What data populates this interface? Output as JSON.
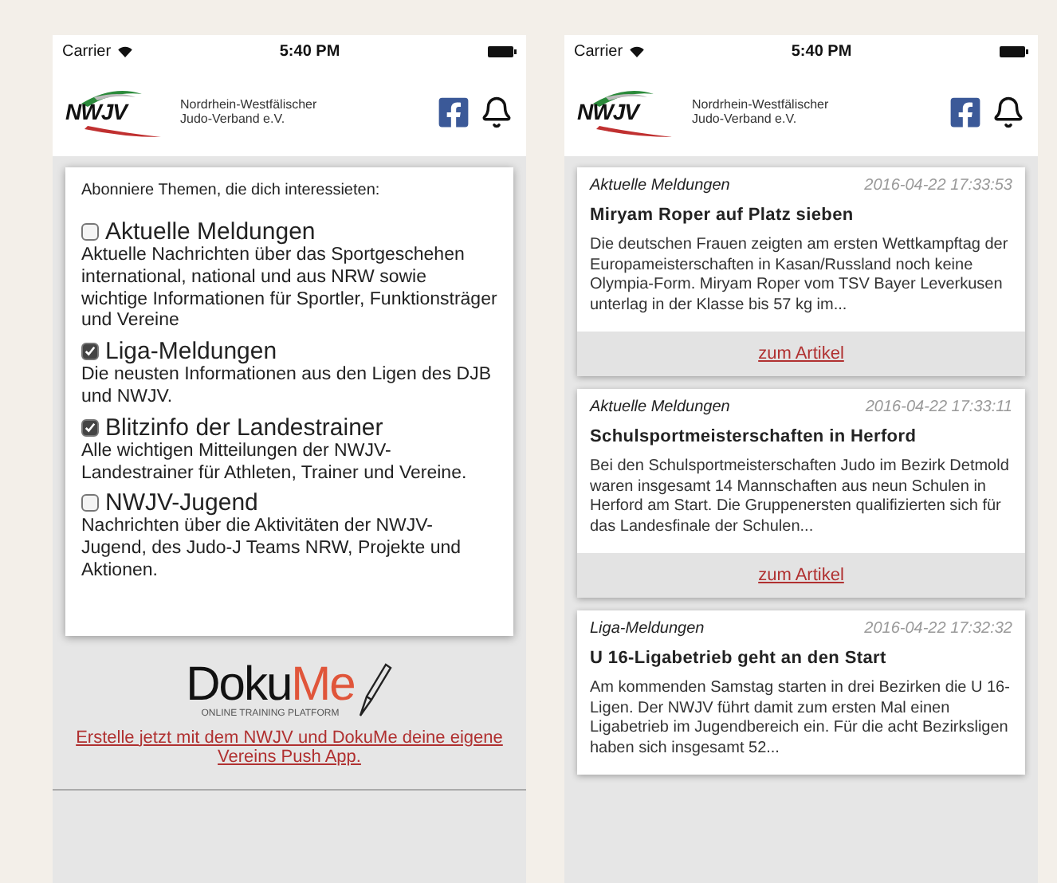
{
  "screens": [
    {
      "kind": "topics",
      "status_bar": {
        "carrier": "Carrier",
        "time": "5:40 PM"
      },
      "header": {
        "logo_text": "NWJV",
        "org_lines": [
          "Nordrhein-Westfälischer",
          "Judo-Verband e.V."
        ]
      },
      "intro": "Abonniere Themen, die dich interessieten:",
      "topics": [
        {
          "title": "Aktuelle Meldungen",
          "description": "Aktuelle Nachrichten über das Sportgeschehen international, national und aus NRW sowie wichtige Informationen für Sportler, Funktionsträger und Vereine",
          "checked": false
        },
        {
          "title": "Liga-Meldungen",
          "description": "Die neusten Informationen aus den Ligen des DJB und NWJV.",
          "checked": true
        },
        {
          "title": "Blitzinfo der Landestrainer",
          "description": "Alle wichtigen Mitteilungen der NWJV-Landestrainer für Athleten, Trainer und Vereine.",
          "checked": true
        },
        {
          "title": "NWJV-Jugend",
          "description": "Nachrichten über die Aktivitäten der NWJV-Jugend, des Judo-J Teams NRW, Projekte und Aktionen.",
          "checked": false
        }
      ],
      "promo": {
        "brand_dark": "Doku",
        "brand_accent": "Me",
        "tagline": "ONLINE TRAINING PLATFORM",
        "link": "Erstelle jetzt mit dem NWJV und DokuMe deine eigene Vereins Push App."
      }
    },
    {
      "kind": "news",
      "status_bar": {
        "carrier": "Carrier",
        "time": "5:40 PM"
      },
      "header": {
        "logo_text": "NWJV",
        "org_lines": [
          "Nordrhein-Westfälischer",
          "Judo-Verband e.V."
        ]
      },
      "articles": [
        {
          "category": "Aktuelle Meldungen",
          "timestamp": "2016-04-22 17:33:53",
          "title": "Miryam Roper auf Platz sieben",
          "excerpt": "Die deutschen Frauen zeigten am ersten Wettkampftag der Europameisterschaften in Kasan/Russland noch keine Olympia-Form. Miryam Roper vom TSV Bayer Leverkusen unterlag in der Klasse bis 57 kg im...",
          "link": "zum Artikel"
        },
        {
          "category": "Aktuelle Meldungen",
          "timestamp": "2016-04-22 17:33:11",
          "title": "Schulsportmeisterschaften in Herford",
          "excerpt": "Bei den Schulsportmeisterschaften Judo im Bezirk Detmold waren insgesamt 14 Mannschaften aus neun Schulen in Herford am Start. Die Gruppenersten qualifizierten sich für das Landesfinale der Schulen...",
          "link": "zum Artikel"
        },
        {
          "category": "Liga-Meldungen",
          "timestamp": "2016-04-22 17:32:32",
          "title": "U 16-Ligabetrieb geht an den Start",
          "excerpt": "Am kommenden Samstag starten in drei Bezirken die U 16-Ligen. Der NWJV führt damit zum ersten Mal einen Ligabetrieb im Jugendbereich ein. Für die acht Bezirksligen haben sich insgesamt 52..."
        }
      ]
    }
  ]
}
